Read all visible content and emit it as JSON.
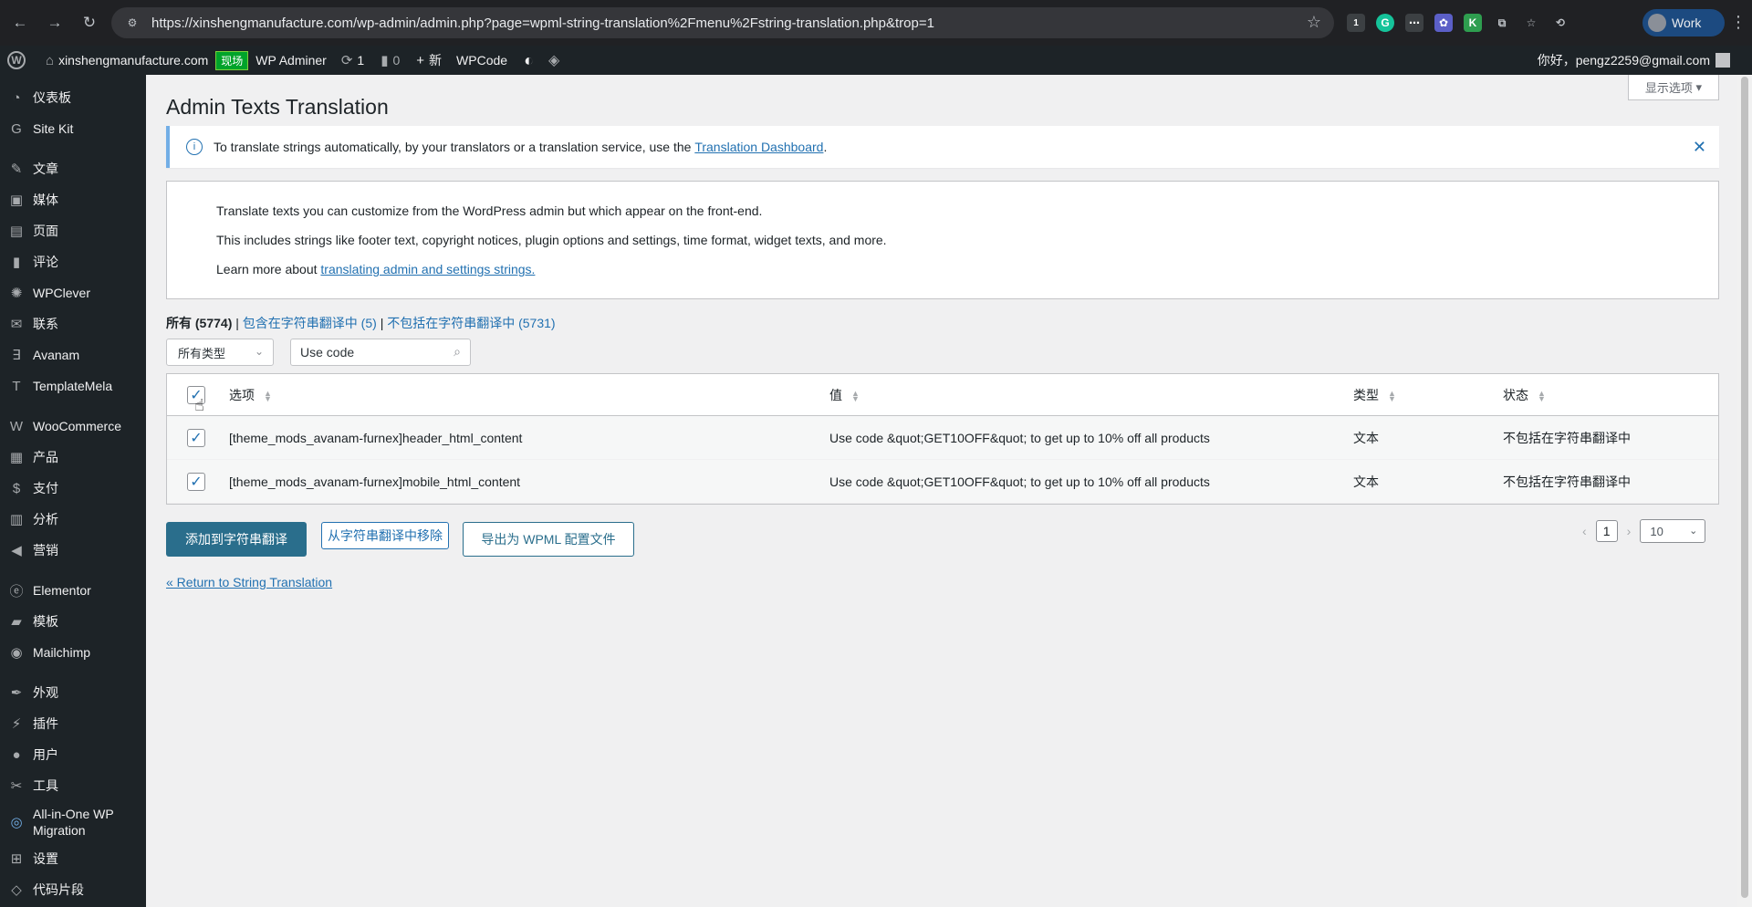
{
  "browser": {
    "url": "https://xinshengmanufacture.com/wp-admin/admin.php?page=wpml-string-translation%2Fmenu%2Fstring-translation.php&trop=1",
    "profile": "Work",
    "ext_badge": "1"
  },
  "adminbar": {
    "site": "xinshengmanufacture.com",
    "live": "现场",
    "adminer": "WP Adminer",
    "updates": "1",
    "comments": "0",
    "new": "新",
    "wpcode": "WPCode",
    "greeting": "你好，pengz2259@gmail.com"
  },
  "sidebar": {
    "items": [
      {
        "label": "仪表板",
        "icon": "dashboard-icon"
      },
      {
        "label": "Site Kit",
        "icon": "sitekit-icon"
      },
      {
        "label": "文章",
        "icon": "pin-icon"
      },
      {
        "label": "媒体",
        "icon": "media-icon"
      },
      {
        "label": "页面",
        "icon": "page-icon"
      },
      {
        "label": "评论",
        "icon": "comment-icon"
      },
      {
        "label": "WPClever",
        "icon": "gear-icon"
      },
      {
        "label": "联系",
        "icon": "mail-icon"
      },
      {
        "label": "Avanam",
        "icon": "avanam-icon"
      },
      {
        "label": "TemplateMela",
        "icon": "template-icon"
      },
      {
        "label": "WooCommerce",
        "icon": "woo-icon"
      },
      {
        "label": "产品",
        "icon": "box-icon"
      },
      {
        "label": "支付",
        "icon": "dollar-icon"
      },
      {
        "label": "分析",
        "icon": "chart-icon"
      },
      {
        "label": "营销",
        "icon": "megaphone-icon"
      },
      {
        "label": "Elementor",
        "icon": "elementor-icon"
      },
      {
        "label": "模板",
        "icon": "folder-icon"
      },
      {
        "label": "Mailchimp",
        "icon": "mailchimp-icon"
      },
      {
        "label": "外观",
        "icon": "brush-icon"
      },
      {
        "label": "插件",
        "icon": "plugin-icon"
      },
      {
        "label": "用户",
        "icon": "user-icon"
      },
      {
        "label": "工具",
        "icon": "wrench-icon"
      },
      {
        "label": "All-in-One WP Migration",
        "icon": "migration-icon"
      },
      {
        "label": "设置",
        "icon": "settings-icon"
      },
      {
        "label": "代码片段",
        "icon": "code-icon"
      }
    ]
  },
  "page": {
    "screen_options": "显示选项",
    "title": "Admin Texts Translation",
    "notice_text": "To translate strings automatically, by your translators or a translation service, use the",
    "notice_link": "Translation Dashboard",
    "notice_end": ".",
    "info_line1": "Translate texts you can customize from the WordPress admin but which appear on the front-end.",
    "info_line2": "This includes strings like footer text, copyright notices, plugin options and settings, time format, widget texts, and more.",
    "info_line3_prefix": "Learn more about",
    "info_line3_link": "translating admin and settings strings.",
    "filter_all": "所有",
    "filter_all_count": "(5774)",
    "filter_sep": "|",
    "filter_included": "包含在字符串翻译中",
    "filter_included_count": "(5)",
    "filter_excluded": "不包括在字符串翻译中",
    "filter_excluded_count": "(5731)",
    "type_select": "所有类型",
    "search_value": "Use code"
  },
  "table": {
    "headers": [
      "选项",
      "值",
      "类型",
      "状态"
    ],
    "rows": [
      {
        "option": "[theme_mods_avanam-furnex]header_html_content",
        "value": "Use code &quot;GET10OFF&quot; to get up to 10% off all products",
        "type": "文本",
        "status": "不包括在字符串翻译中",
        "checked": true
      },
      {
        "option": "[theme_mods_avanam-furnex]mobile_html_content",
        "value": "Use code &quot;GET10OFF&quot; to get up to 10% off all products",
        "type": "文本",
        "status": "不包括在字符串翻译中",
        "checked": true
      }
    ]
  },
  "actions": {
    "add": "添加到字符串翻译",
    "remove": "从字符串翻译中移除",
    "export": "导出为 WPML 配置文件",
    "page": "1",
    "per_page": "10",
    "return": "« Return to String Translation"
  }
}
